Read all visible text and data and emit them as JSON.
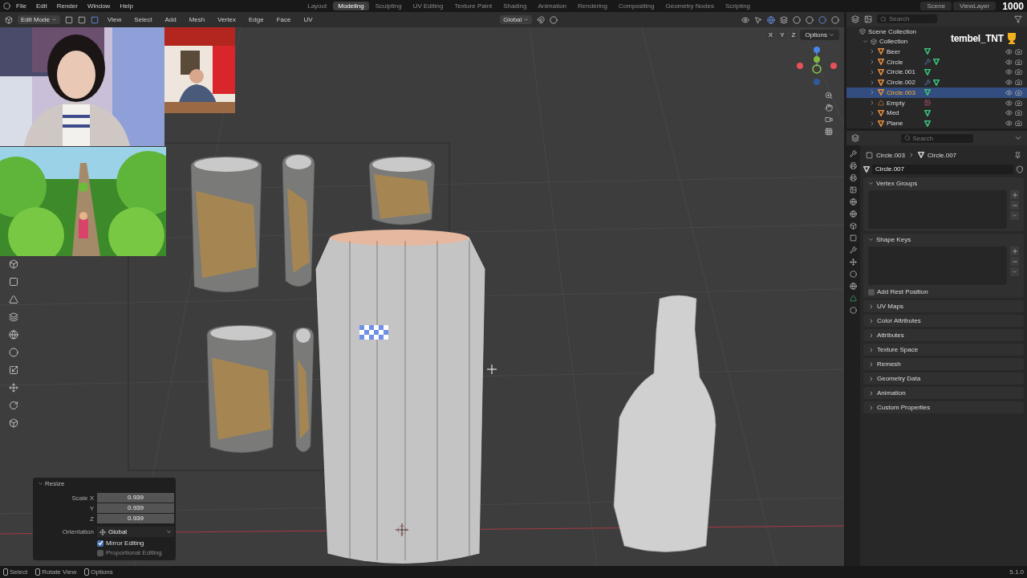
{
  "menu": [
    "File",
    "Edit",
    "Render",
    "Window",
    "Help"
  ],
  "workspaces": [
    {
      "label": "Layout",
      "selected": false
    },
    {
      "label": "Modeling",
      "selected": true
    },
    {
      "label": "Sculpting",
      "selected": false
    },
    {
      "label": "UV Editing",
      "selected": false
    },
    {
      "label": "Texture Paint",
      "selected": false
    },
    {
      "label": "Shading",
      "selected": false
    },
    {
      "label": "Animation",
      "selected": false
    },
    {
      "label": "Rendering",
      "selected": false
    },
    {
      "label": "Compositing",
      "selected": false
    },
    {
      "label": "Geometry Nodes",
      "selected": false
    },
    {
      "label": "Scripting",
      "selected": false
    }
  ],
  "scene": "Scene",
  "view_layer": "ViewLayer",
  "viewport_header": {
    "mode": "Edit Mode",
    "menus": [
      "View",
      "Select",
      "Add",
      "Mesh",
      "Vertex",
      "Edge",
      "Face",
      "UV"
    ],
    "orientation": "Global",
    "axes": [
      "X",
      "Y",
      "Z"
    ],
    "options": "Options"
  },
  "stream_overlay": {
    "streamer": "tembel_TNT",
    "count": "1000"
  },
  "outliner": {
    "search": {
      "placeholder": "Search"
    },
    "root": "Scene Collection",
    "collection": {
      "label": "Collection",
      "expanded": true,
      "children": [
        {
          "label": "Beer",
          "kind": "mesh",
          "modifier": false,
          "selected": false
        },
        {
          "label": "Circle",
          "kind": "mesh",
          "modifier": true,
          "selected": false
        },
        {
          "label": "Circle.001",
          "kind": "mesh",
          "modifier": false,
          "selected": false
        },
        {
          "label": "Circle.002",
          "kind": "mesh",
          "modifier": true,
          "selected": false
        },
        {
          "label": "Circle.003",
          "kind": "mesh",
          "modifier": false,
          "selected": true
        },
        {
          "label": "Empty",
          "kind": "empty",
          "modifier": false,
          "selected": false
        },
        {
          "label": "Med",
          "kind": "mesh",
          "modifier": false,
          "selected": false
        },
        {
          "label": "Plane",
          "kind": "mesh",
          "modifier": false,
          "selected": false
        }
      ]
    }
  },
  "properties": {
    "search": {
      "placeholder": "Search"
    },
    "breadcrumb": [
      "Circle.003",
      "Circle.007"
    ],
    "mesh_name": "Circle.007",
    "panels": [
      {
        "title": "Vertex Groups",
        "expanded": true,
        "kind": "list"
      },
      {
        "title": "Shape Keys",
        "expanded": true,
        "kind": "list",
        "option": {
          "label": "Add Rest Position",
          "checked": false
        }
      },
      {
        "title": "UV Maps",
        "expanded": false
      },
      {
        "title": "Color Attributes",
        "expanded": false
      },
      {
        "title": "Attributes",
        "expanded": false
      },
      {
        "title": "Texture Space",
        "expanded": false
      },
      {
        "title": "Remesh",
        "expanded": false
      },
      {
        "title": "Geometry Data",
        "expanded": false
      },
      {
        "title": "Animation",
        "expanded": false
      },
      {
        "title": "Custom Properties",
        "expanded": false
      }
    ]
  },
  "operator_panel": {
    "title": "Resize",
    "fields": [
      {
        "label": "Scale X",
        "value": "0.939"
      },
      {
        "label": "Y",
        "value": "0.939"
      },
      {
        "label": "Z",
        "value": "0.939"
      }
    ],
    "orientation": {
      "label": "Orientation",
      "value": "Global"
    },
    "options": [
      {
        "label": "Mirror Editing",
        "checked": true
      },
      {
        "label": "Proportional Editing",
        "checked": false
      }
    ]
  },
  "status_bar": {
    "hints": [
      "Select",
      "Rotate View",
      "Options"
    ],
    "version": "5.1.0"
  }
}
